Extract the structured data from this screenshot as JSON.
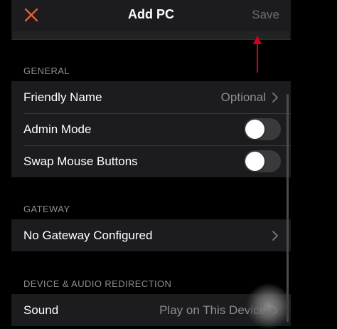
{
  "nav": {
    "title": "Add PC",
    "save_label": "Save",
    "close_icon": "close-x-icon",
    "accent_color": "#e0622b"
  },
  "sections": {
    "general": {
      "header": "GENERAL",
      "friendly_name": {
        "label": "Friendly Name",
        "value": "Optional"
      },
      "admin_mode": {
        "label": "Admin Mode",
        "enabled": false
      },
      "swap_mouse": {
        "label": "Swap Mouse Buttons",
        "enabled": false
      }
    },
    "gateway": {
      "header": "GATEWAY",
      "gateway_row": {
        "label": "No Gateway Configured"
      }
    },
    "redirection": {
      "header": "DEVICE & AUDIO REDIRECTION",
      "sound": {
        "label": "Sound",
        "value": "Play on This Device"
      }
    }
  },
  "annotation": {
    "color": "#d0021b"
  }
}
